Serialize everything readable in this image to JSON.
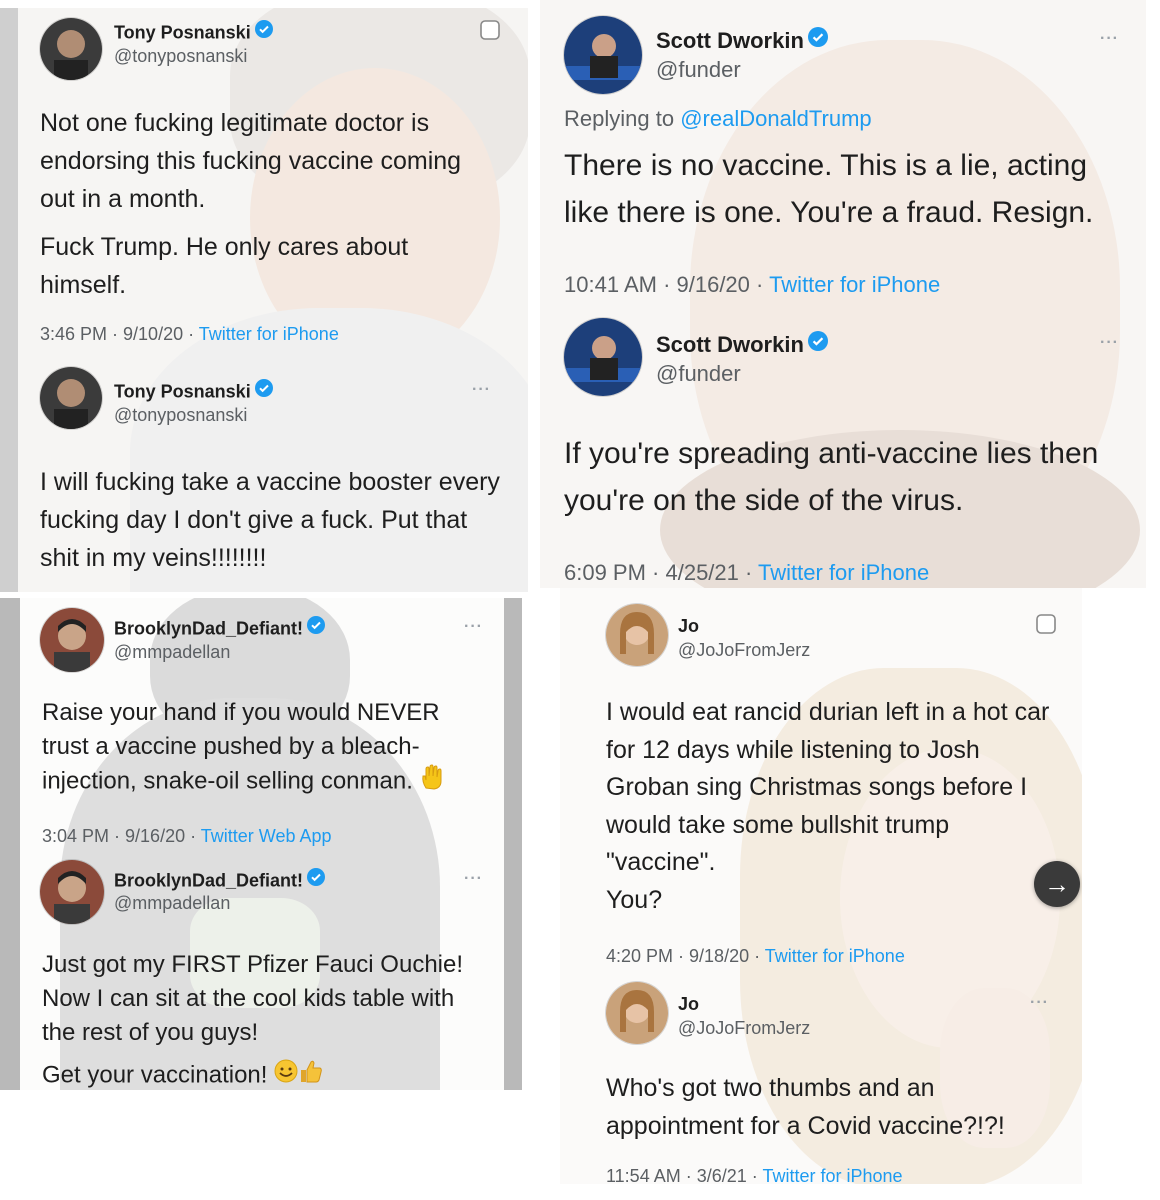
{
  "panels": {
    "tony": {
      "tweets": [
        {
          "name": "Tony Posnanski",
          "handle": "@tonyposnanski",
          "body": [
            "Not one fucking legitimate doctor is endorsing this fucking vaccine coming out in a month.",
            "Fuck Trump. He only cares about himself."
          ],
          "time": "3:46 PM · 9/10/20 · ",
          "source": "Twitter for iPhone"
        },
        {
          "name": "Tony Posnanski",
          "handle": "@tonyposnanski",
          "body": [
            "I will fucking take a vaccine booster every fucking day I don't give a fuck. Put that shit in my veins!!!!!!!!"
          ]
        }
      ]
    },
    "scott": {
      "tweets": [
        {
          "name": "Scott Dworkin",
          "handle": "@funder",
          "reply_prefix": "Replying to ",
          "reply_mention": "@realDonaldTrump",
          "body": [
            "There is no vaccine. This is a lie, acting like there is one. You're a fraud. Resign."
          ],
          "time": "10:41 AM · 9/16/20 · ",
          "source": "Twitter for iPhone"
        },
        {
          "name": "Scott Dworkin",
          "handle": "@funder",
          "body": [
            "If you're spreading anti-vaccine lies then you're on the side of the virus."
          ],
          "time": "6:09 PM · 4/25/21 · ",
          "source": "Twitter for iPhone"
        }
      ]
    },
    "brooklyn": {
      "tweets": [
        {
          "name": "BrooklynDad_Defiant!",
          "handle": "@mmpadellan",
          "body": [
            "Raise your hand if you would NEVER trust a vaccine pushed by a bleach-injection, snake-oil selling conman."
          ],
          "time": "3:04 PM · 9/16/20 · ",
          "source": "Twitter Web App"
        },
        {
          "name": "BrooklynDad_Defiant!",
          "handle": "@mmpadellan",
          "body": [
            "Just got my FIRST Pfizer Fauci Ouchie! Now I can sit at the cool kids table with the rest of you guys!",
            "Get your vaccination!"
          ]
        }
      ]
    },
    "jo": {
      "tweets": [
        {
          "name": "Jo",
          "handle": "@JoJoFromJerz",
          "body": [
            "I would eat rancid durian left in a hot car for 12 days while listening to Josh Groban sing Christmas songs before I would take some bullshit trump \"vaccine\".",
            "You?"
          ],
          "time": "4:20 PM · 9/18/20 · ",
          "source": "Twitter for iPhone"
        },
        {
          "name": "Jo",
          "handle": "@JoJoFromJerz",
          "body": [
            "Who's got two thumbs and an appointment for a Covid vaccine?!?!"
          ],
          "time": "11:54 AM · 3/6/21 · ",
          "source": "Twitter for iPhone"
        }
      ]
    }
  },
  "icons": {
    "more": "···",
    "next_arrow": "→",
    "verified": "verified-badge-icon",
    "raised_hand": "raised-hand-emoji",
    "smile": "smiling-face-emoji",
    "thumbs_up": "thumbs-up-emoji"
  },
  "colors": {
    "link_blue": "#1d9bf0",
    "verified_blue": "#1d9bf0",
    "meta_gray": "#5b5f63"
  }
}
